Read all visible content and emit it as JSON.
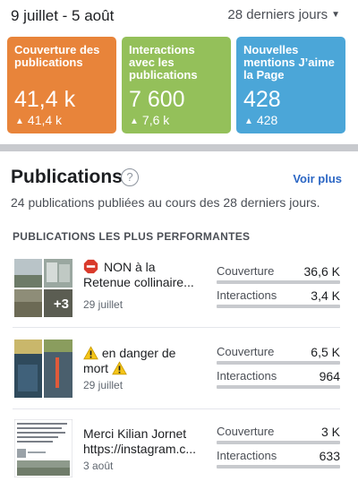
{
  "header": {
    "date_range": "9 juillet - 5 août",
    "period_select": "28 derniers jours",
    "period_icon": "caret-down-icon"
  },
  "cards": [
    {
      "label": "Couverture des publications",
      "value": "41,4 k",
      "delta": "41,4 k",
      "color": "#e8843a",
      "icon": "arrow-up-icon"
    },
    {
      "label": "Interactions avec les publications",
      "value": "7 600",
      "delta": "7,6 k",
      "color": "#94c05a",
      "icon": "arrow-up-icon"
    },
    {
      "label": "Nouvelles mentions J’aime la Page",
      "value": "428",
      "delta": "428",
      "color": "#4ba6d8",
      "icon": "arrow-up-icon"
    }
  ],
  "publications": {
    "title": "Publications",
    "help_icon": "question-circle-icon",
    "see_more": "Voir plus",
    "subtitle": "24 publications publiées au cours des 28 derniers jours.",
    "section_label": "PUBLICATIONS LES PLUS PERFORMANTES",
    "posts": [
      {
        "text_line1": "NON à la",
        "text_line2": "Retenue collinaire...",
        "emoji": "stop-sign-icon",
        "date": "29 juillet",
        "thumb_extra": "+3",
        "metrics": [
          {
            "label": "Couverture",
            "value": "36,6 K"
          },
          {
            "label": "Interactions",
            "value": "3,4 K"
          }
        ]
      },
      {
        "text_line1": "en danger de",
        "text_line2": "mort",
        "emoji": "warning-icon",
        "date": "29 juillet",
        "metrics": [
          {
            "label": "Couverture",
            "value": "6,5 K"
          },
          {
            "label": "Interactions",
            "value": "964"
          }
        ]
      },
      {
        "text_line1": "Merci Kilian Jornet",
        "text_line2": "https://instagram.c...",
        "date": "3 août",
        "metrics": [
          {
            "label": "Couverture",
            "value": "3 K"
          },
          {
            "label": "Interactions",
            "value": "633"
          }
        ]
      }
    ]
  }
}
